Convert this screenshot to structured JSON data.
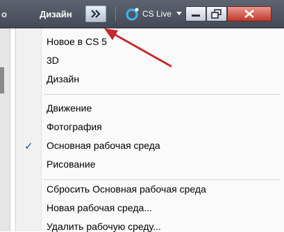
{
  "topbar": {
    "prev_label": "о",
    "workspace_label": "Дизайн",
    "chevron_icon": "double-chevron-right",
    "cslive_label": "CS Live",
    "cslive_icon": "cs-live-icon",
    "window_buttons": [
      "minimize-icon",
      "restore-icon",
      "close-icon"
    ]
  },
  "menu": {
    "group1": [
      "Новое в CS 5",
      "3D",
      "Дизайн"
    ],
    "group2": [
      "Движение",
      "Фотография",
      "Основная рабочая среда",
      "Рисование"
    ],
    "checked_item": "Основная рабочая среда",
    "check_mark": "✓",
    "group3": [
      "Сбросить Основная рабочая среда",
      "Новая рабочая среда...",
      "Удалить рабочую среду..."
    ]
  },
  "colors": {
    "topbar": "#4c535e",
    "arrow": "#c62828",
    "close_button": "#c0392b",
    "check": "#1d4fa8"
  }
}
